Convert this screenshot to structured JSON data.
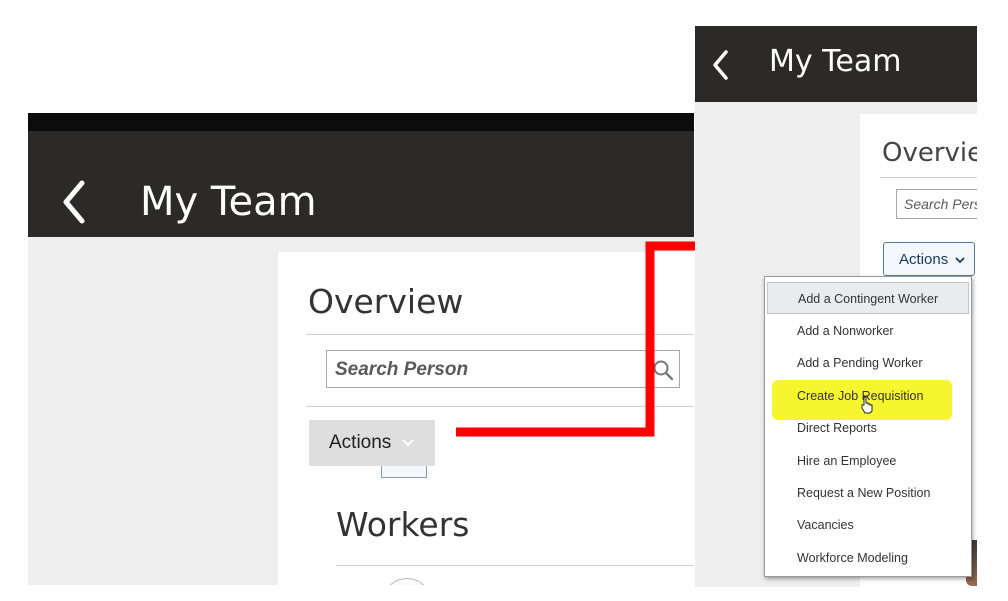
{
  "left_panel": {
    "header_title": "My Team",
    "overview_title": "Overview",
    "search_placeholder": "Search Person",
    "actions_label": "Actions",
    "workers_title": "Workers"
  },
  "right_panel": {
    "header_title": "My Team",
    "overview_title": "Overview",
    "search_placeholder": "Search Pers",
    "actions_label": "Actions"
  },
  "actions_menu": {
    "items": [
      {
        "label": "Add a Contingent Worker"
      },
      {
        "label": "Add a Nonworker"
      },
      {
        "label": "Add a Pending Worker"
      },
      {
        "label": "Create Job Requisition"
      },
      {
        "label": "Direct Reports"
      },
      {
        "label": "Hire an Employee"
      },
      {
        "label": "Request a New Position"
      },
      {
        "label": "Vacancies"
      },
      {
        "label": "Workforce Modeling"
      }
    ]
  },
  "colors": {
    "header_bg": "#2c2a28",
    "arrow": "#ff0000",
    "highlight": "#f5f51a",
    "actions_border": "#4f7aa6"
  },
  "icons": [
    "back-chevron-icon",
    "search-icon",
    "chevron-down-icon",
    "pointer-cursor-icon",
    "avatar-icon"
  ]
}
